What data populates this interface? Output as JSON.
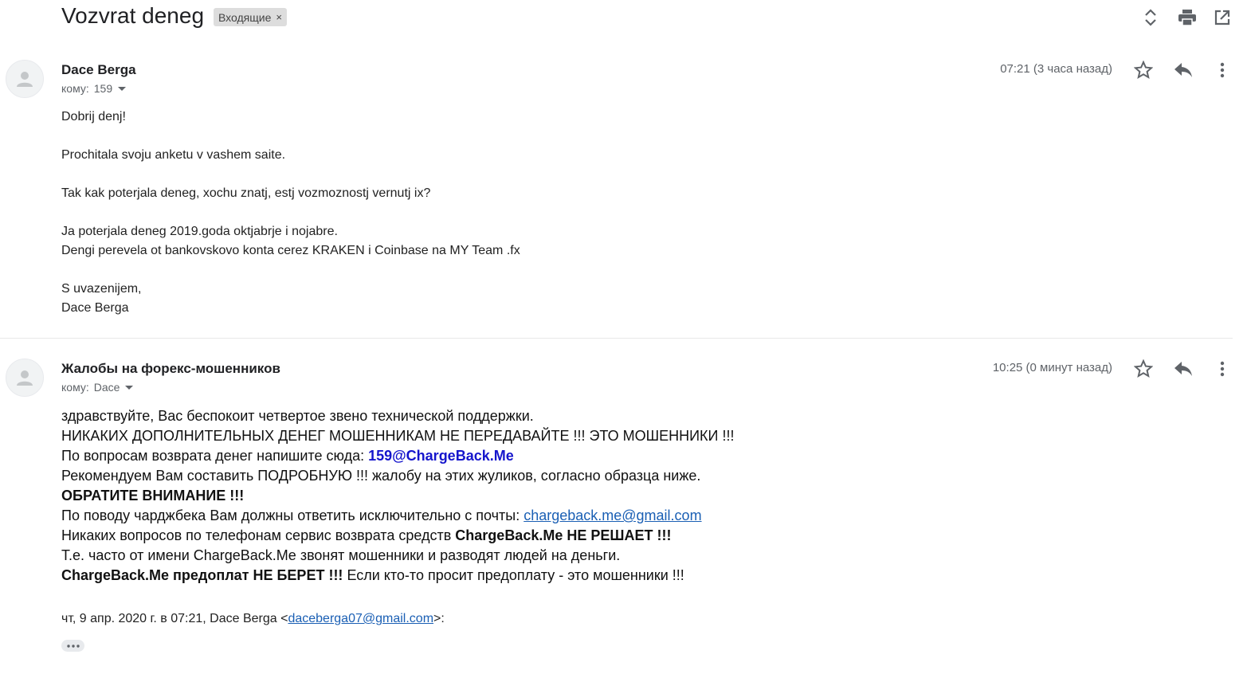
{
  "header": {
    "subject": "Vozvrat deneg",
    "label": "Входящие",
    "label_close": "×",
    "icons": [
      "expand-collapse-icon",
      "print-icon",
      "open-in-new-window-icon"
    ]
  },
  "messages": [
    {
      "sender": "Dace Berga",
      "to_label": "кому:",
      "to_value": "159",
      "time": "07:21 (3 часа назад)",
      "body_lines": [
        "Dobrij denj!",
        "",
        "Prochitala svoju anketu v vashem saite.",
        "",
        "Tak kak poterjala deneg, xochu znatj, estj vozmoznostj vernutj ix?",
        "",
        "Ja poterjala deneg 2019.goda oktjabrje i nojabre.",
        "Dengi perevela ot bankovskovo konta cerez KRAKEN i Coinbase na MY Team .fx",
        "",
        "S uvazenijem,",
        "Dace Berga"
      ]
    },
    {
      "sender": "Жалобы на форекс-мошенников",
      "to_label": "кому:",
      "to_value": "Dace",
      "time": "10:25 (0 минут назад)",
      "line1": "здравствуйте, Вас беспокоит четвертое звено технической поддержки.",
      "line2": "НИКАКИХ ДОПОЛНИТЕЛЬНЫХ ДЕНЕГ МОШЕННИКАМ НЕ ПЕРЕДАВАЙТЕ !!! ЭТО МОШЕННИКИ !!!",
      "line3_text": "По вопросам возврата денег напишите сюда: ",
      "line3_email": "159@ChargeBack.Me",
      "line4": "Рекомендуем Вам составить ПОДРОБНУЮ !!! жалобу на этих жуликов, согласно образца ниже.",
      "line5": "ОБРАТИТЕ ВНИМАНИЕ !!!",
      "line6_text": "По поводу чарджбека Вам должны ответить исключительно с почты: ",
      "line6_link": "chargeback.me@gmail.com",
      "line7_text": "Никаких вопросов по телефонам сервис возврата средств ",
      "line7_bold": "ChargeBack.Me НЕ РЕШАЕТ !!!",
      "line8": "Т.е. часто от имени ChargeBack.Me звонят мошенники и разводят людей на деньги.",
      "line9_bold": "ChargeBack.Me предоплат НЕ БЕРЕТ !!!",
      "line9_text": " Если кто-то просит предоплату - это мошенники !!!",
      "quote_prefix": "чт, 9 апр. 2020 г. в 07:21, Dace Berga <",
      "quote_email": "daceberga07@gmail.com",
      "quote_suffix": ">:"
    }
  ],
  "colors": {
    "email_bold_blue": "#1515cc",
    "link_blue": "#1a5fb4",
    "icon_gray": "#5f6368"
  }
}
